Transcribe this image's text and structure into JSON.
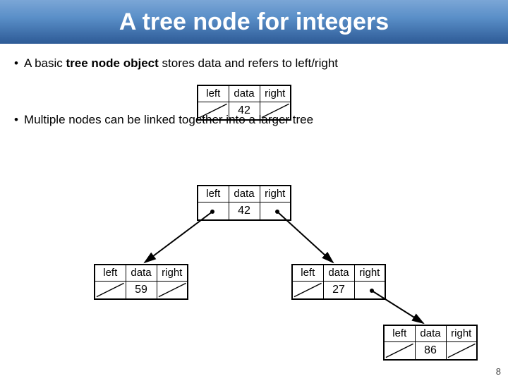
{
  "title": "A tree node for integers",
  "bullets": {
    "b1_pre": "A basic ",
    "b1_bold": "tree node object",
    "b1_post": " stores data and refers to left/right",
    "b2": "Multiple nodes can be linked together into a larger tree"
  },
  "labels": {
    "left": "left",
    "data": "data",
    "right": "right"
  },
  "nodes": {
    "n1": "42",
    "root": "42",
    "childL": "59",
    "childR": "27",
    "grand": "86"
  },
  "page": "8"
}
